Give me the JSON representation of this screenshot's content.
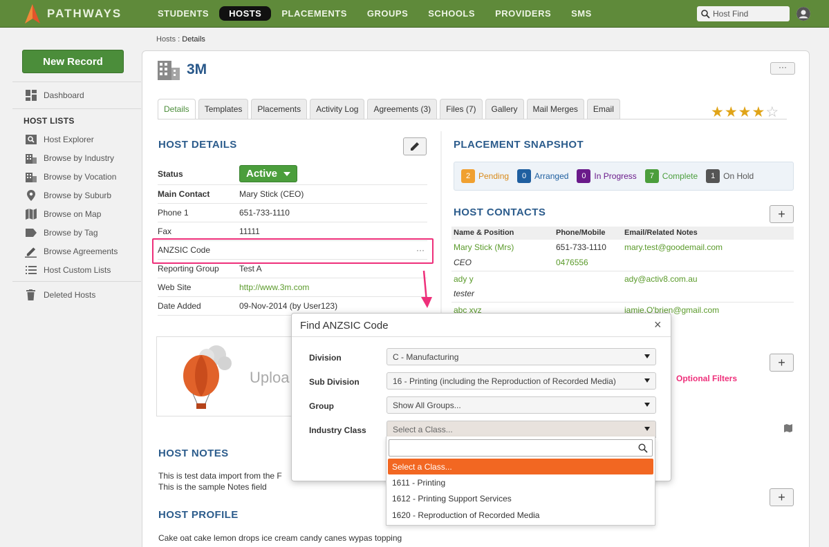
{
  "app": {
    "brand": "PATHWAYS",
    "nav": [
      "STUDENTS",
      "HOSTS",
      "PLACEMENTS",
      "GROUPS",
      "SCHOOLS",
      "PROVIDERS",
      "SMS"
    ],
    "active_nav": "HOSTS",
    "search_placeholder": "Host Find"
  },
  "breadcrumb": {
    "parent": "Hosts",
    "sep": " : ",
    "current": "Details"
  },
  "sidebar": {
    "new_record": "New Record",
    "dashboard": "Dashboard",
    "lists_heading": "HOST LISTS",
    "items": [
      {
        "label": "Host Explorer",
        "icon": "search-icon"
      },
      {
        "label": "Browse by Industry",
        "icon": "building-icon"
      },
      {
        "label": "Browse by Vocation",
        "icon": "building-icon"
      },
      {
        "label": "Browse by Suburb",
        "icon": "map-pin-icon"
      },
      {
        "label": "Browse on Map",
        "icon": "map-icon"
      },
      {
        "label": "Browse by Tag",
        "icon": "tag-icon"
      },
      {
        "label": "Browse Agreements",
        "icon": "pen-icon"
      },
      {
        "label": "Host Custom Lists",
        "icon": "list-icon"
      }
    ],
    "deleted": "Deleted Hosts"
  },
  "host": {
    "name": "3M",
    "more": "···",
    "tabs": [
      "Details",
      "Templates",
      "Placements",
      "Activity Log",
      "Agreements (3)",
      "Files (7)",
      "Gallery",
      "Mail Merges",
      "Email"
    ],
    "active_tab": "Details",
    "stars": "★★★★",
    "empty_star": "☆",
    "rating": 4
  },
  "details": {
    "title": "HOST DETAILS",
    "status_label": "Status",
    "status_value": "Active",
    "rows": [
      {
        "label": "Main Contact",
        "value": "Mary Stick (CEO)"
      },
      {
        "label": "Phone 1",
        "value": "651-733-1110"
      },
      {
        "label": "Fax",
        "value": "11111"
      },
      {
        "label": "ANZSIC Code",
        "value": "···"
      },
      {
        "label": "Reporting Group",
        "value": "Test A"
      },
      {
        "label": "Web Site",
        "value": "http://www.3m.com"
      },
      {
        "label": "Date Added",
        "value": "09-Nov-2014 (by User123)"
      }
    ],
    "upload_text": "Uploa"
  },
  "snapshot": {
    "title": "PLACEMENT SNAPSHOT",
    "items": [
      {
        "count": "2",
        "label": "Pending",
        "color": "#f0a030",
        "text_color": "#d98a1a"
      },
      {
        "count": "0",
        "label": "Arranged",
        "color": "#1f5fa0",
        "text_color": "#1f5fa0"
      },
      {
        "count": "0",
        "label": "In Progress",
        "color": "#6a1a8a",
        "text_color": "#6a1a8a"
      },
      {
        "count": "7",
        "label": "Complete",
        "color": "#4b9e3c",
        "text_color": "#4b9e3c"
      },
      {
        "count": "1",
        "label": "On Hold",
        "color": "#555555",
        "text_color": "#555555"
      }
    ]
  },
  "contacts": {
    "title": "HOST CONTACTS",
    "headers": [
      "Name & Position",
      "Phone/Mobile",
      "Email/Related Notes"
    ],
    "rows": [
      {
        "name": "Mary Stick (Mrs)",
        "position": "CEO",
        "phone": "651-733-1110",
        "mobile": "0476556",
        "email": "mary.test@goodemail.com"
      },
      {
        "name": "ady y",
        "position": "tester",
        "phone": "",
        "mobile": "",
        "email": "ady@activ8.com.au"
      },
      {
        "name": "abc xyz",
        "position": "",
        "phone": "",
        "mobile": "",
        "email": "jamie.O'brien@gmail.com"
      }
    ]
  },
  "notes": {
    "title": "HOST NOTES",
    "line1": "This is test data import from the F",
    "line2": "This is the sample Notes field"
  },
  "profile": {
    "title": "HOST PROFILE",
    "text": "Cake oat cake lemon drops ice cream candy canes wypas topping"
  },
  "annotation": "Optional Filters",
  "modal": {
    "title": "Find ANZSIC Code",
    "close": "×",
    "fields": [
      {
        "label": "Division",
        "value": "C - Manufacturing"
      },
      {
        "label": "Sub Division",
        "value": "16 - Printing (including the Reproduction of Recorded Media)"
      },
      {
        "label": "Group",
        "value": "Show All Groups..."
      },
      {
        "label": "Industry Class",
        "value": "Select a Class..."
      }
    ],
    "options": [
      "Select a Class...",
      "1611 - Printing",
      "1612 - Printing Support Services",
      "1620 - Reproduction of Recorded Media"
    ]
  }
}
